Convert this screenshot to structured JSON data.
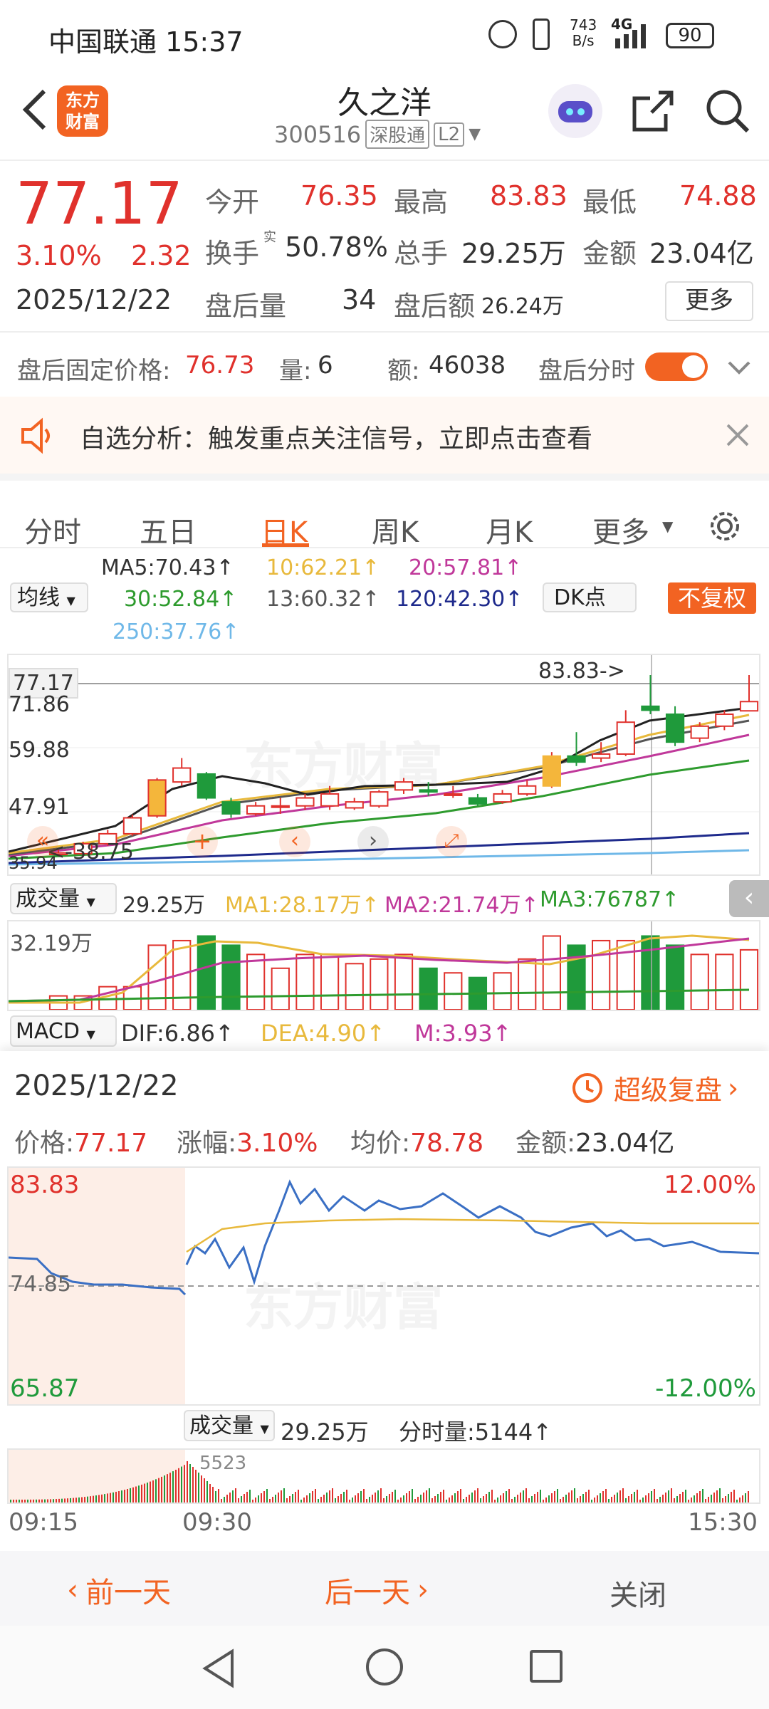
{
  "status": {
    "carrier_time": "中国联通 15:37",
    "net_speed_top": "743",
    "net_speed_bot": "B/s",
    "network": "4G",
    "battery": "90"
  },
  "header": {
    "title": "久之洋",
    "code": "300516",
    "market_tag": "深股通",
    "level_tag": "L2",
    "logo_line1": "东方",
    "logo_line2": "财富"
  },
  "quote": {
    "price": "77.17",
    "change_pct": "3.10%",
    "change_abs": "2.32",
    "date": "2025/12/22",
    "open_label": "今开",
    "open": "76.35",
    "high_label": "最高",
    "high": "83.83",
    "low_label": "最低",
    "low": "74.88",
    "turnover_label": "换手",
    "turnover_sup": "实",
    "turnover": "50.78%",
    "volume_label": "总手",
    "volume": "29.25万",
    "amount_label": "金额",
    "amount": "23.04亿",
    "ah_vol_label": "盘后量",
    "ah_vol": "34",
    "ah_amt_label": "盘后额",
    "ah_amt": "26.24万",
    "more_btn": "更多"
  },
  "afterhours": {
    "fixed_price_label": "盘后固定价格:",
    "fixed_price": "76.73",
    "qty_label": "量:",
    "qty": "6",
    "amt_label": "额:",
    "amt": "46038",
    "timeshare_label": "盘后分时"
  },
  "notice": {
    "text": "自选分析：触发重点关注信号，立即点击查看"
  },
  "tabs": [
    "分时",
    "五日",
    "日K",
    "周K",
    "月K",
    "更多"
  ],
  "active_tab": "日K",
  "ma_legend": {
    "ma5": "MA5:70.43↑",
    "ma10": "10:62.21↑",
    "ma20": "20:57.81↑",
    "ma30": "30:52.84↑",
    "ma13": "13:60.32↑",
    "ma120": "120:42.30↑",
    "ma250": "250:37.76↑",
    "select_label": "均线",
    "dk_label": "DK点",
    "fq_label": "不复权",
    "colors": {
      "ma5": "#222222",
      "ma10": "#e8b93c",
      "ma20": "#c0389a",
      "ma30": "#2e9b2e",
      "ma13": "#555555",
      "ma120": "#1e2a8c",
      "ma250": "#6fb8e8"
    }
  },
  "kchart": {
    "y_top": "83.83",
    "y_label_1": "71.86",
    "y_label_2": "59.88",
    "y_label_3": "47.91",
    "y_label_4": "35.94",
    "cursor_price": "77.17",
    "high_marker": "83.83->",
    "low_marker": "<-38.75",
    "watermark": "东方财富"
  },
  "volume": {
    "select_label": "成交量",
    "value": "29.25万",
    "ma1": "MA1:28.17万↑",
    "ma2": "MA2:21.74万↑",
    "ma3": "MA3:76787↑",
    "y_label": "32.19万"
  },
  "macd": {
    "select_label": "MACD",
    "dif": "DIF:6.86↑",
    "dea": "DEA:4.90↑",
    "m": "M:3.93↑"
  },
  "review": {
    "date": "2025/12/22",
    "super_review": "超级复盘",
    "price_label": "价格:",
    "price": "77.17",
    "pct_label": "涨幅:",
    "pct": "3.10%",
    "avg_label": "均价:",
    "avg": "78.78",
    "amt_label": "金额:",
    "amt": "23.04亿",
    "y_high": "83.83",
    "y_mid": "74.85",
    "y_low": "65.87",
    "pct_high": "12.00%",
    "pct_low": "-12.00%",
    "vol_select": "成交量",
    "vol_value": "29.25万",
    "tick_vol": "分时量:5144↑",
    "vol_peak": "5523",
    "t_start": "09:15",
    "t_mid": "09:30",
    "t_end": "15:30"
  },
  "bottom": {
    "prev": "前一天",
    "next": "后一天",
    "close": "关闭"
  },
  "chart_data": {
    "type": "candlestick",
    "ylim": [
      35.94,
      83.83
    ],
    "candles": [
      {
        "o": 38.8,
        "c": 39.2,
        "h": 40.0,
        "l": 38.75
      },
      {
        "o": 39.0,
        "c": 41.5,
        "h": 42.0,
        "l": 38.9
      },
      {
        "o": 41.5,
        "c": 44.0,
        "h": 45.0,
        "l": 41.0
      },
      {
        "o": 44.0,
        "c": 48.0,
        "h": 48.8,
        "l": 43.5
      },
      {
        "o": 48.5,
        "c": 57.5,
        "h": 58.0,
        "l": 48.0
      },
      {
        "o": 57.0,
        "c": 60.5,
        "h": 63.0,
        "l": 56.0
      },
      {
        "o": 59.0,
        "c": 53.0,
        "h": 59.5,
        "l": 52.5
      },
      {
        "o": 52.0,
        "c": 49.0,
        "h": 53.0,
        "l": 48.0
      },
      {
        "o": 49.0,
        "c": 51.0,
        "h": 52.0,
        "l": 48.5
      },
      {
        "o": 51.0,
        "c": 51.0,
        "h": 53.0,
        "l": 49.0
      },
      {
        "o": 51.0,
        "c": 53.0,
        "h": 54.0,
        "l": 50.0
      },
      {
        "o": 51.0,
        "c": 54.0,
        "h": 56.0,
        "l": 50.0
      },
      {
        "o": 50.5,
        "c": 52.0,
        "h": 53.0,
        "l": 50.0
      },
      {
        "o": 51.0,
        "c": 54.5,
        "h": 55.0,
        "l": 50.5
      },
      {
        "o": 55.0,
        "c": 57.0,
        "h": 58.0,
        "l": 54.0
      },
      {
        "o": 55.0,
        "c": 54.5,
        "h": 57.0,
        "l": 53.5
      },
      {
        "o": 54.0,
        "c": 54.0,
        "h": 56.0,
        "l": 53.0
      },
      {
        "o": 53.0,
        "c": 51.5,
        "h": 54.0,
        "l": 51.0
      },
      {
        "o": 52.0,
        "c": 54.0,
        "h": 55.0,
        "l": 51.5
      },
      {
        "o": 54.0,
        "c": 56.0,
        "h": 57.5,
        "l": 53.5
      },
      {
        "o": 56.0,
        "c": 63.5,
        "h": 64.5,
        "l": 55.5
      },
      {
        "o": 63.5,
        "c": 62.0,
        "h": 69.5,
        "l": 61.0
      },
      {
        "o": 63.0,
        "c": 64.0,
        "h": 67.0,
        "l": 62.0
      },
      {
        "o": 64.0,
        "c": 72.0,
        "h": 75.0,
        "l": 63.5
      },
      {
        "o": 76.0,
        "c": 75.0,
        "h": 83.83,
        "l": 74.0
      },
      {
        "o": 74.0,
        "c": 67.0,
        "h": 76.0,
        "l": 66.0
      },
      {
        "o": 68.0,
        "c": 71.0,
        "h": 72.0,
        "l": 67.0
      },
      {
        "o": 71.0,
        "c": 74.0,
        "h": 75.0,
        "l": 70.0
      },
      {
        "o": 74.85,
        "c": 77.17,
        "h": 83.83,
        "l": 74.88
      }
    ]
  }
}
